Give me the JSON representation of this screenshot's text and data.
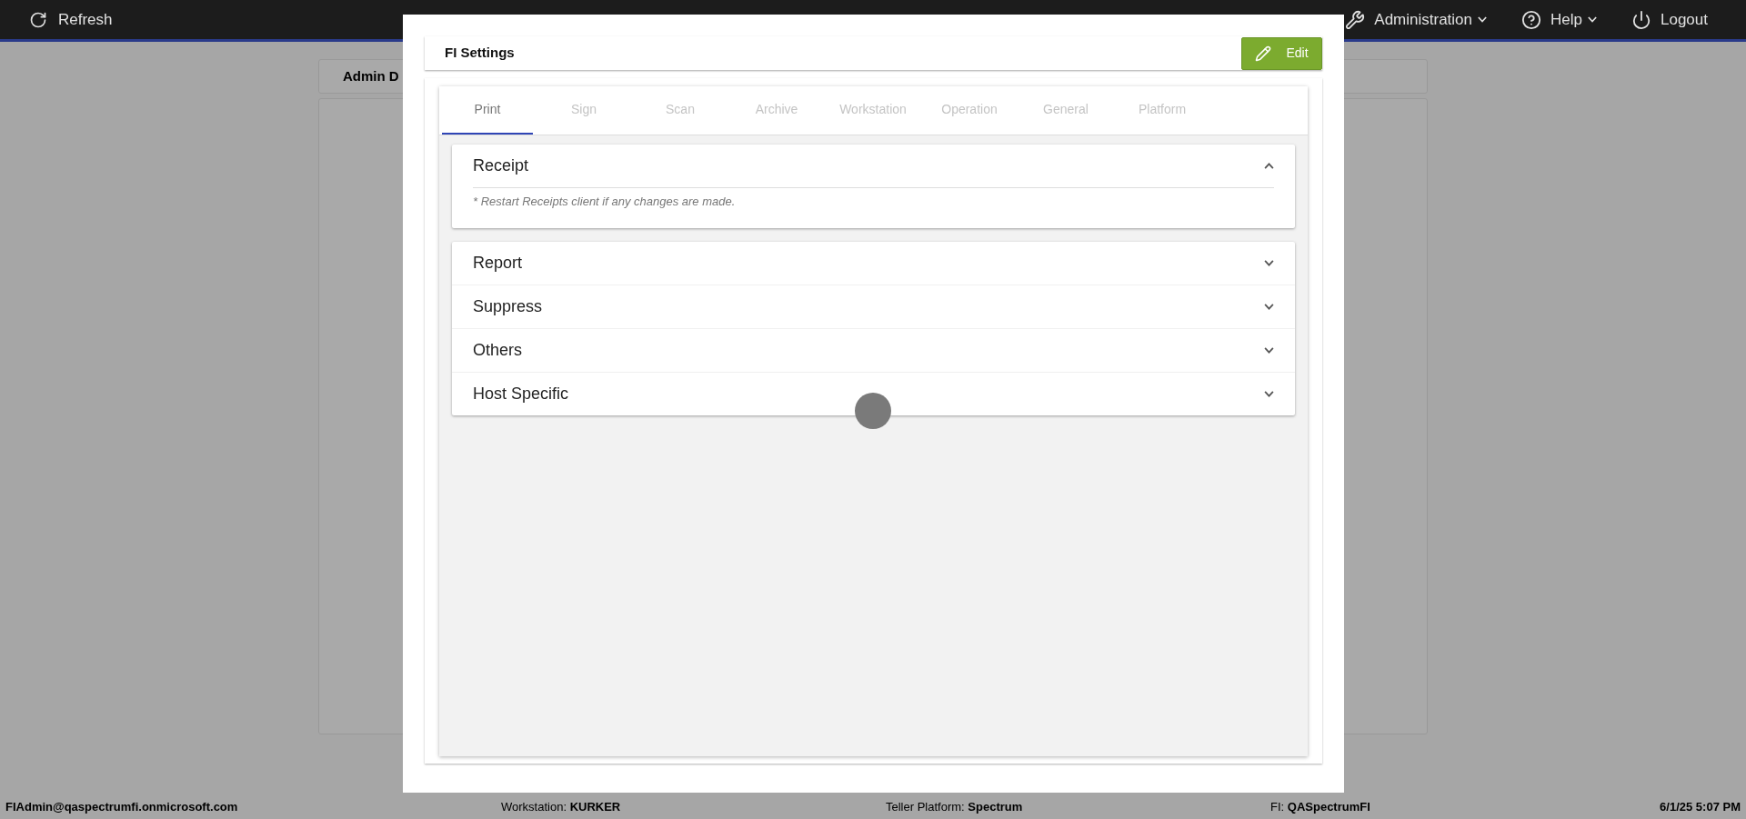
{
  "top_bar": {
    "refresh": "Refresh",
    "menus": [
      {
        "label": "Administration",
        "kind": "wrench",
        "dropdown": true
      },
      {
        "label": "Help",
        "kind": "help",
        "dropdown": true
      },
      {
        "label": "Logout",
        "kind": "power",
        "dropdown": false
      }
    ]
  },
  "background": {
    "card_title": "Admin D"
  },
  "dialog": {
    "title": "FI Settings",
    "edit_button": "Edit",
    "tabs": [
      {
        "label": "Print",
        "selected": true
      },
      {
        "label": "Sign",
        "selected": false
      },
      {
        "label": "Scan",
        "selected": false
      },
      {
        "label": "Archive",
        "selected": false
      },
      {
        "label": "Workstation",
        "selected": false
      },
      {
        "label": "Operation",
        "selected": false
      },
      {
        "label": "General",
        "selected": false
      },
      {
        "label": "Platform",
        "selected": false
      }
    ],
    "sections": [
      {
        "title": "Receipt",
        "expanded": true,
        "note": "* Restart Receipts client if any changes are made."
      },
      {
        "title": "Report",
        "expanded": false
      },
      {
        "title": "Suppress",
        "expanded": false
      },
      {
        "title": "Others",
        "expanded": false
      },
      {
        "title": "Host Specific",
        "expanded": false
      }
    ]
  },
  "status_bar": {
    "user": "FIAdmin@qaspectrumfi.onmicrosoft.com",
    "fields": [
      {
        "label": "Workstation:",
        "value": "KURKER"
      },
      {
        "label": "Teller Platform:",
        "value": "Spectrum"
      },
      {
        "label": "FI:",
        "value": "QASpectrumFI"
      }
    ],
    "datetime": "6/1/25 5:07 PM"
  }
}
